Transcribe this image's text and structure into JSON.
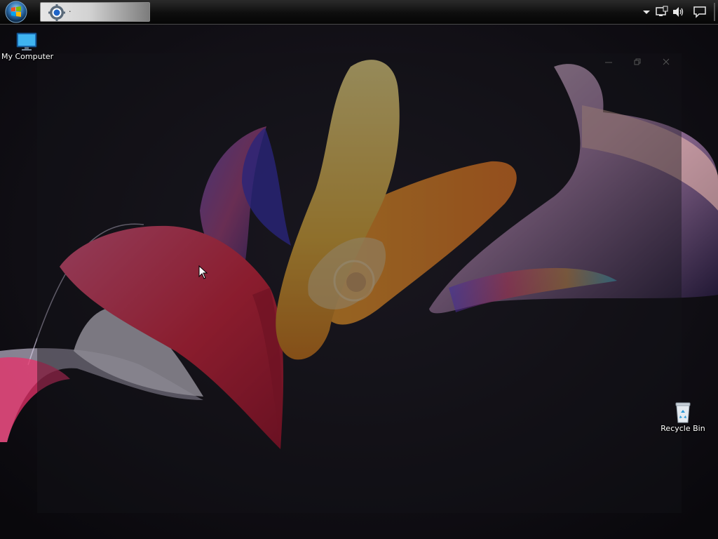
{
  "taskbar": {
    "task_item": {
      "label": "·",
      "icon": "gear-icon"
    },
    "tray": {
      "expand_icon": "chevron-up-icon",
      "network_icon": "network-icon",
      "volume_icon": "speaker-icon",
      "notification_icon": "action-center-icon"
    }
  },
  "desktop": {
    "icons": [
      {
        "label": "My Computer",
        "icon": "monitor-icon"
      },
      {
        "label": "Recycle Bin",
        "icon": "recycle-bin-icon"
      }
    ]
  },
  "window": {
    "controls": [
      "minimize-icon",
      "restore-icon",
      "close-icon"
    ]
  },
  "colors": {
    "taskbar": "#0e0e0e",
    "wallpaper_bg": "#15131a",
    "accent_pink": "#e0305a",
    "accent_orange": "#f0a030",
    "accent_purple": "#6a3fd0"
  }
}
